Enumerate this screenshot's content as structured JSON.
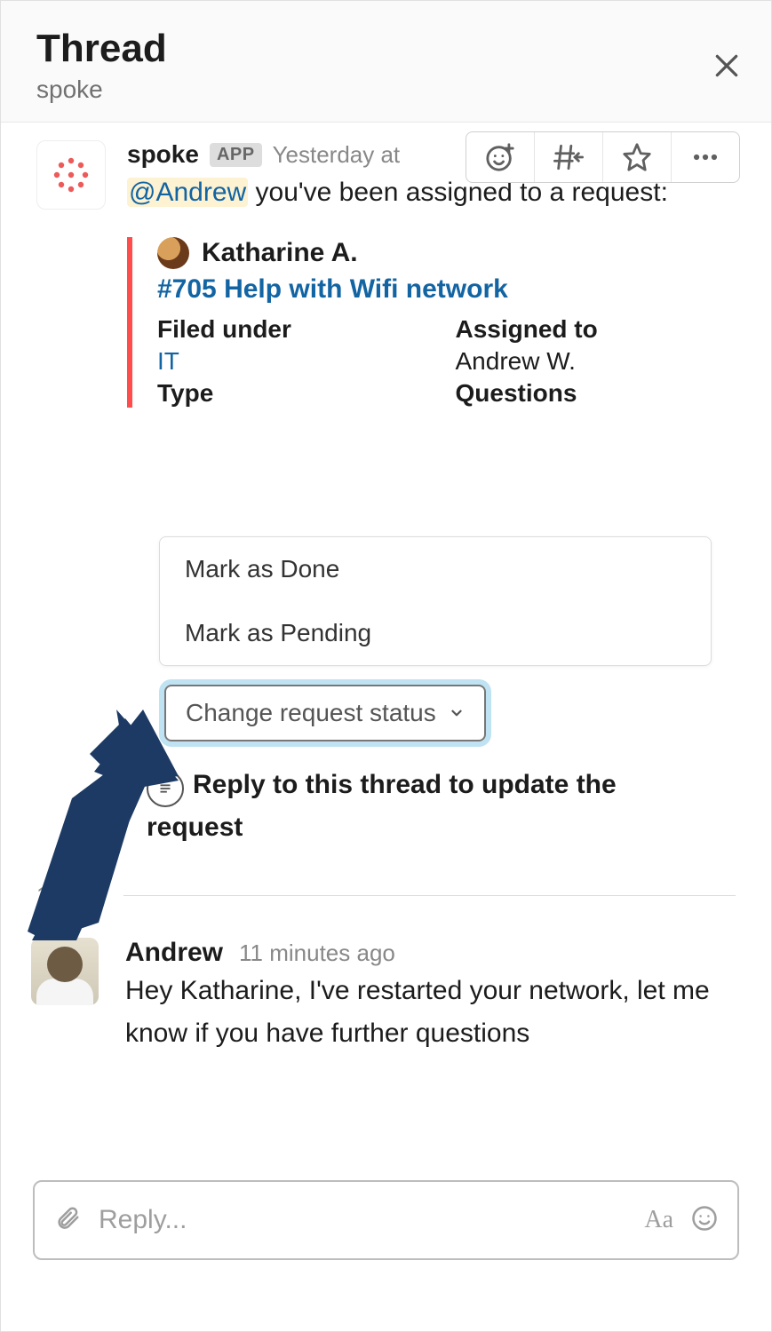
{
  "header": {
    "title": "Thread",
    "subtitle": "spoke"
  },
  "message1": {
    "sender": "spoke",
    "app_badge": "APP",
    "timestamp": "Yesterday at",
    "mention": "@Andrew",
    "body_rest": " you've been assigned to a request:"
  },
  "attachment": {
    "requester": "Katharine A.",
    "ticket_link": "#705 Help with Wifi network",
    "filed_under_label": "Filed under",
    "filed_under_value": "IT",
    "assigned_to_label": "Assigned to",
    "assigned_to_value": "Andrew W.",
    "type_label": "Type",
    "questions_label": "Questions"
  },
  "dropdown": {
    "items": [
      "Mark as Done",
      "Mark as Pending"
    ]
  },
  "status_button": "Change request status",
  "reply_hint": "Reply to this thread to update the request",
  "replies_count": "1 reply",
  "message2": {
    "sender": "Andrew",
    "timestamp": "11 minutes ago",
    "body": "Hey Katharine, I've restarted your network, let me know if you have further questions"
  },
  "composer": {
    "placeholder": "Reply..."
  }
}
